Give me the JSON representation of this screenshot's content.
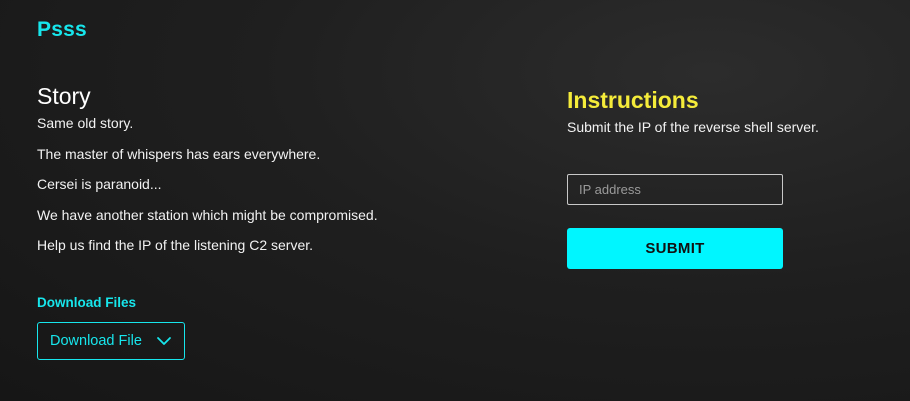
{
  "header": {
    "title": "Psss"
  },
  "story": {
    "heading": "Story",
    "lines": [
      "Same old story.",
      "The master of whispers has ears everywhere.",
      "Cersei is paranoid...",
      "We have another station which might be compromised.",
      "Help us find the IP of the listening C2 server."
    ]
  },
  "downloads": {
    "label": "Download Files",
    "button_label": "Download File",
    "icon": "chevron-down-icon"
  },
  "instructions": {
    "heading": "Instructions",
    "text": "Submit the IP of the reverse shell server."
  },
  "form": {
    "ip_placeholder": "IP address",
    "ip_value": "",
    "submit_label": "SUBMIT"
  },
  "colors": {
    "accent_cyan": "#17e6ec",
    "submit_bg": "#00f6ff",
    "instructions_yellow": "#f5ec3a",
    "background": "#1f1f1f"
  }
}
